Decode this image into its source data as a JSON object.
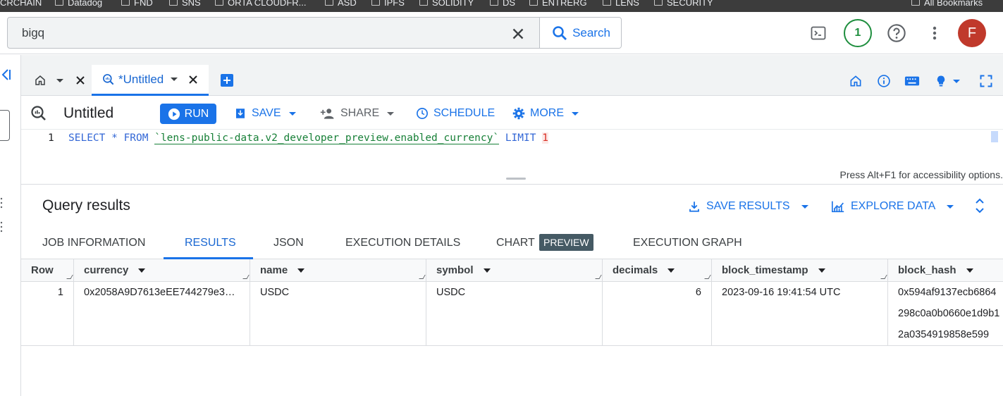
{
  "bookmarks": [
    "CRCHAIN",
    "Datadog",
    "FND",
    "SNS",
    "ORTA CLOUDFR...",
    "ASD",
    "IPFS",
    "SOLIDITY",
    "DS",
    "ENTRERG",
    "LENS",
    "SECURITY",
    "All Bookmarks"
  ],
  "search": {
    "value": "bigq",
    "button_label": "Search"
  },
  "header": {
    "notification_count": "1",
    "avatar_letter": "F"
  },
  "tabs": [
    {
      "label": "*Untitled"
    }
  ],
  "toolbar": {
    "title": "Untitled",
    "run_label": "RUN",
    "save_label": "SAVE",
    "share_label": "SHARE",
    "schedule_label": "SCHEDULE",
    "more_label": "MORE"
  },
  "editor": {
    "line_number": "1",
    "keyword_select": "SELECT * FROM ",
    "table_ref": "`lens-public-data.v2_developer_preview.enabled_currency`",
    "keyword_limit": " LIMIT ",
    "limit_value": "1",
    "accessibility_hint": "Press Alt+F1 for accessibility options."
  },
  "results": {
    "title": "Query results",
    "save_results_label": "SAVE RESULTS",
    "explore_data_label": "EXPLORE DATA",
    "tabs": [
      "JOB INFORMATION",
      "RESULTS",
      "JSON",
      "EXECUTION DETAILS",
      "CHART",
      "EXECUTION GRAPH"
    ],
    "chart_badge": "PREVIEW",
    "columns": [
      "Row",
      "currency",
      "name",
      "symbol",
      "decimals",
      "block_timestamp",
      "block_hash"
    ],
    "rows": [
      {
        "row": "1",
        "currency": "0x2058A9D7613eEE744279e3…",
        "name": "USDC",
        "symbol": "USDC",
        "decimals": "6",
        "block_timestamp": "2023-09-16 19:41:54 UTC",
        "block_hash": [
          "0x594af9137ecb6864",
          "298c0a0b0660e1d9b1",
          "2a0354919858e599"
        ]
      }
    ]
  },
  "colors": {
    "accent": "#1a73e8",
    "run_bg": "#1a73e8",
    "avatar_bg": "#c0392b",
    "badge_green": "#1e8e3e"
  }
}
